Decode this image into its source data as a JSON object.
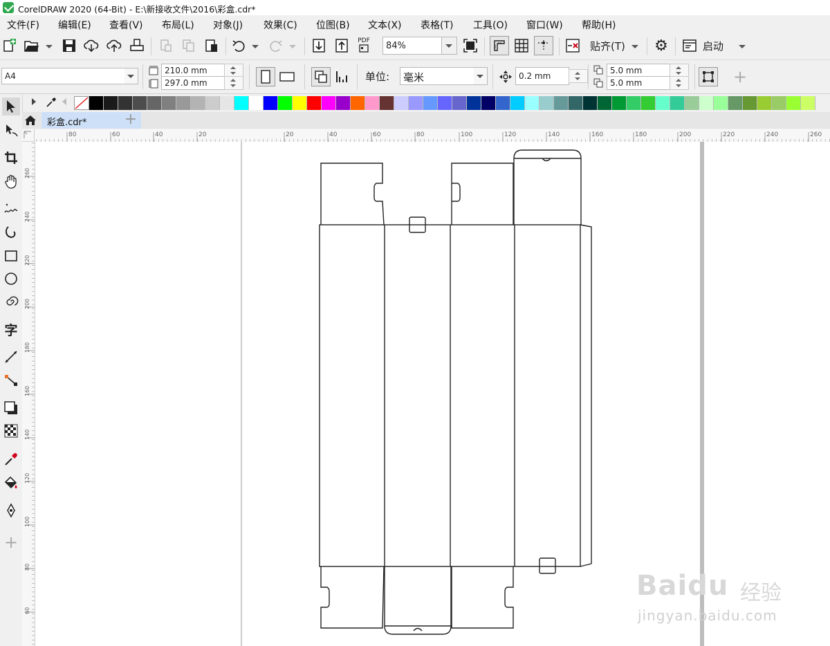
{
  "window": {
    "title": "CorelDRAW 2020 (64-Bit) - E:\\新接收文件\\2016\\彩盒.cdr*"
  },
  "menu": [
    "文件(F)",
    "编辑(E)",
    "查看(V)",
    "布局(L)",
    "对象(J)",
    "效果(C)",
    "位图(B)",
    "文本(X)",
    "表格(T)",
    "工具(O)",
    "窗口(W)",
    "帮助(H)"
  ],
  "standard_toolbar": {
    "zoom": "84%",
    "snap_label": "贴齐(T)",
    "launch_label": "启动",
    "pdf_label": "PDF"
  },
  "property_bar": {
    "page_size": "A4",
    "width": "210.0 mm",
    "height": "297.0 mm",
    "units_label": "单位:",
    "units_value": "毫米",
    "nudge": "0.2 mm",
    "dup_x": "5.0 mm",
    "dup_y": "5.0 mm"
  },
  "document_tab": {
    "name": "彩盒.cdr*"
  },
  "ruler_h_labels": [
    "80",
    "60",
    "40",
    "20",
    "20",
    "40",
    "60",
    "80",
    "100",
    "120",
    "140",
    "160",
    "180",
    "200",
    "220",
    "240",
    "260"
  ],
  "ruler_v_labels": [
    "260",
    "240",
    "220",
    "200",
    "180",
    "160",
    "140",
    "120",
    "100",
    "80",
    "60"
  ],
  "palette": [
    "#000000",
    "#1a1a1a",
    "#333333",
    "#4d4d4d",
    "#666666",
    "#808080",
    "#999999",
    "#b3b3b3",
    "#cccccc",
    "#e6e6e6",
    "#00ffff",
    "#ffffff",
    "#0000ff",
    "#00ff00",
    "#ffff00",
    "#ff0000",
    "#ff00ff",
    "#9900cc",
    "#ff6600",
    "#ff99cc",
    "#663333",
    "#ccccff",
    "#9999ff",
    "#6699ff",
    "#6666ff",
    "#6666cc",
    "#003399",
    "#000066",
    "#3366cc",
    "#00ccff",
    "#99ffff",
    "#99cccc",
    "#669999",
    "#336666",
    "#003333",
    "#006633",
    "#009933",
    "#33cc66",
    "#33cc33",
    "#66ffcc",
    "#33cc99",
    "#99cc99",
    "#ccffcc",
    "#99ff99",
    "#669966",
    "#669933",
    "#99cc33",
    "#99cc66",
    "#99ff33",
    "#ccff66"
  ],
  "watermark": {
    "logo": "Baidu",
    "brand": "经验",
    "url": "jingyan.baidu.com"
  }
}
